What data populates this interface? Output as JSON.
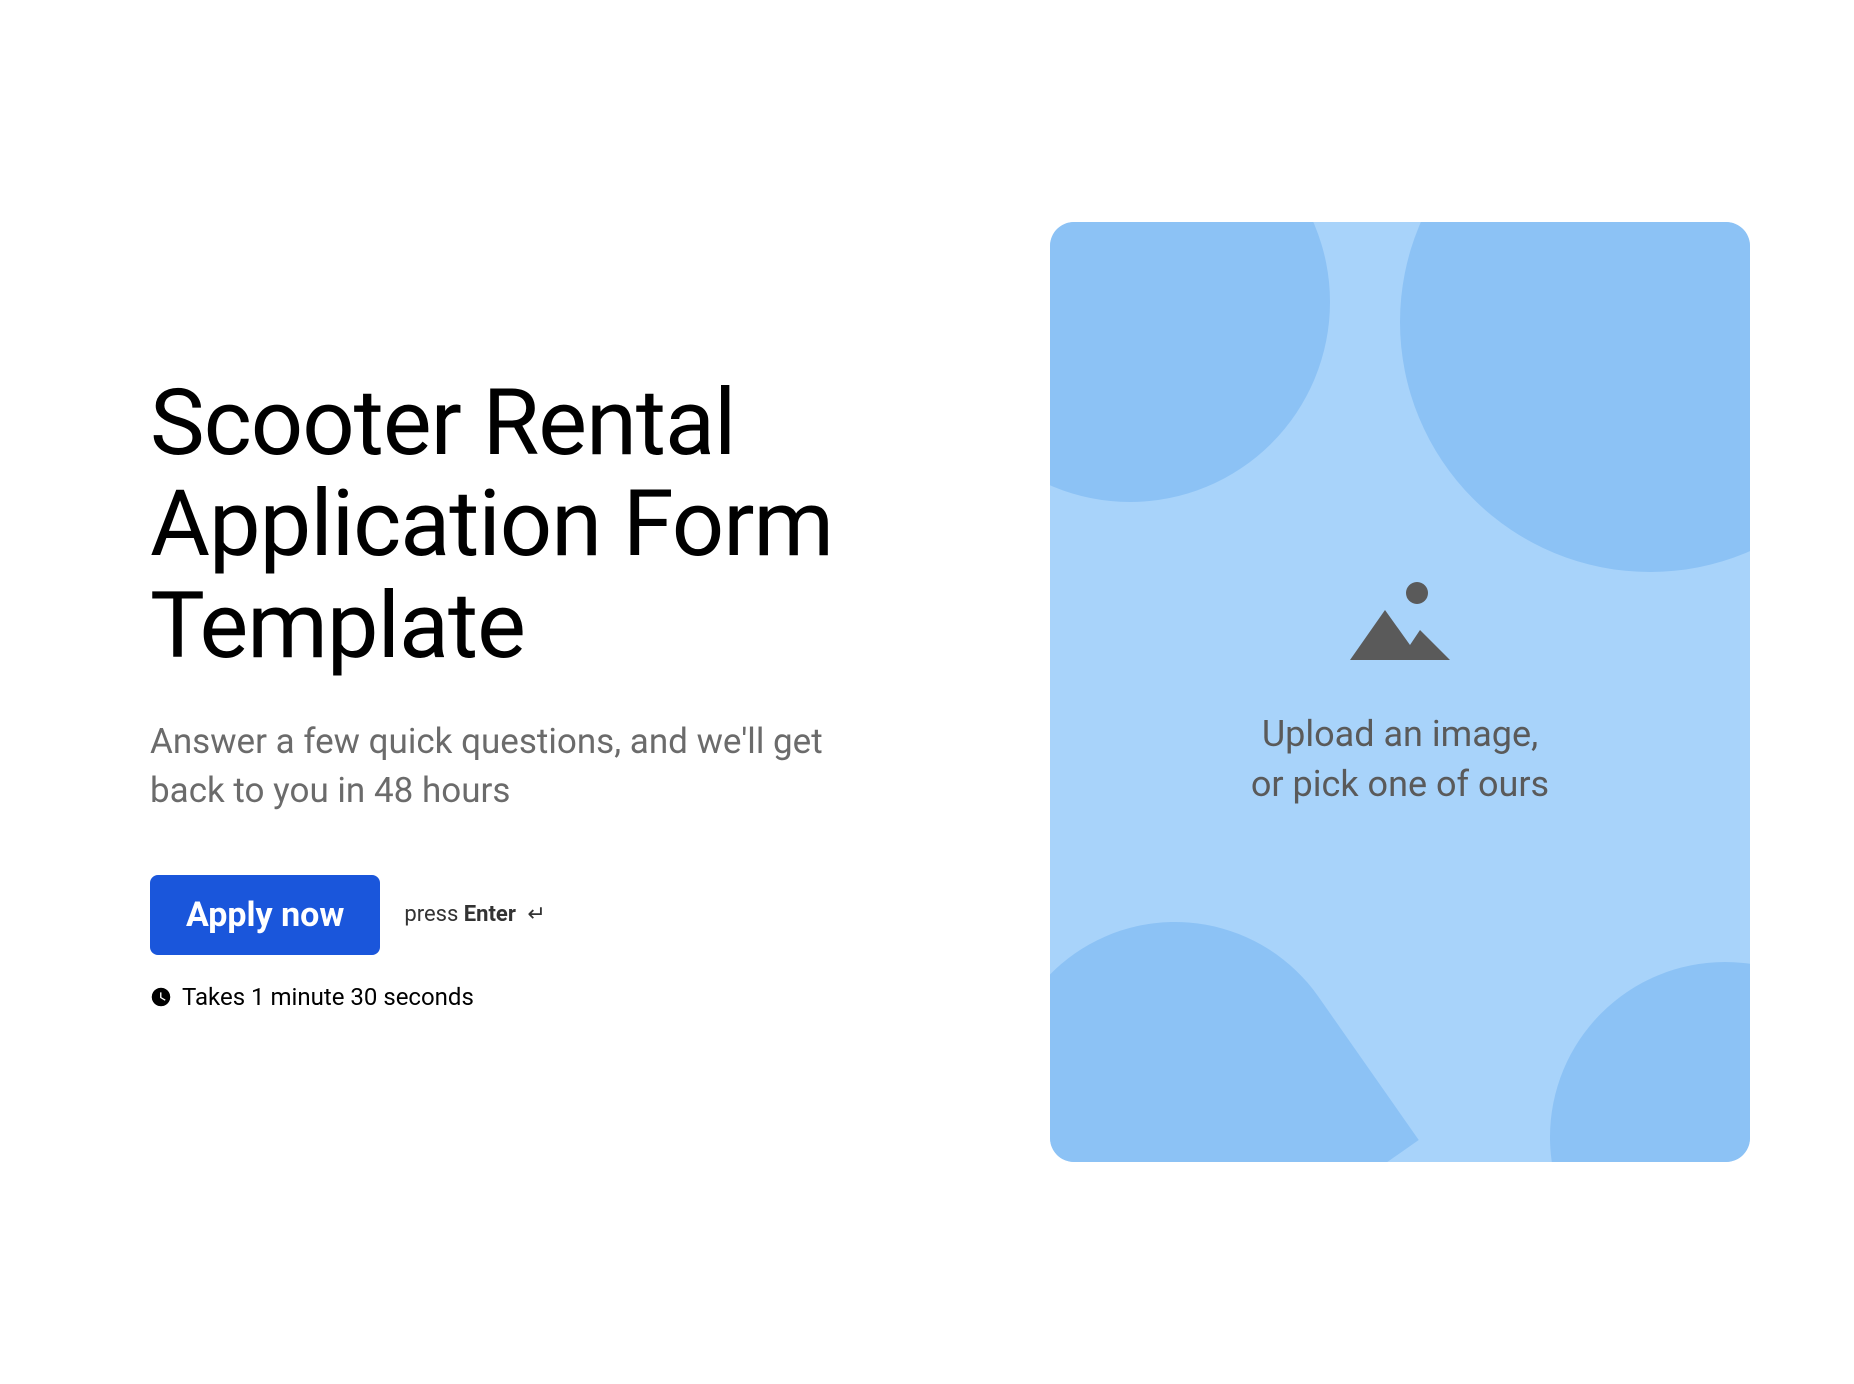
{
  "heading": "Scooter Rental Application Form Template",
  "subheading": "Answer a few quick questions, and we'll get back to you in 48 hours",
  "cta": {
    "button_label": "Apply now",
    "hint_prefix": "press ",
    "hint_key": "Enter"
  },
  "time_estimate": "Takes 1 minute 30 seconds",
  "upload_area": {
    "line1": "Upload an image,",
    "line2": "or pick one of ours"
  }
}
